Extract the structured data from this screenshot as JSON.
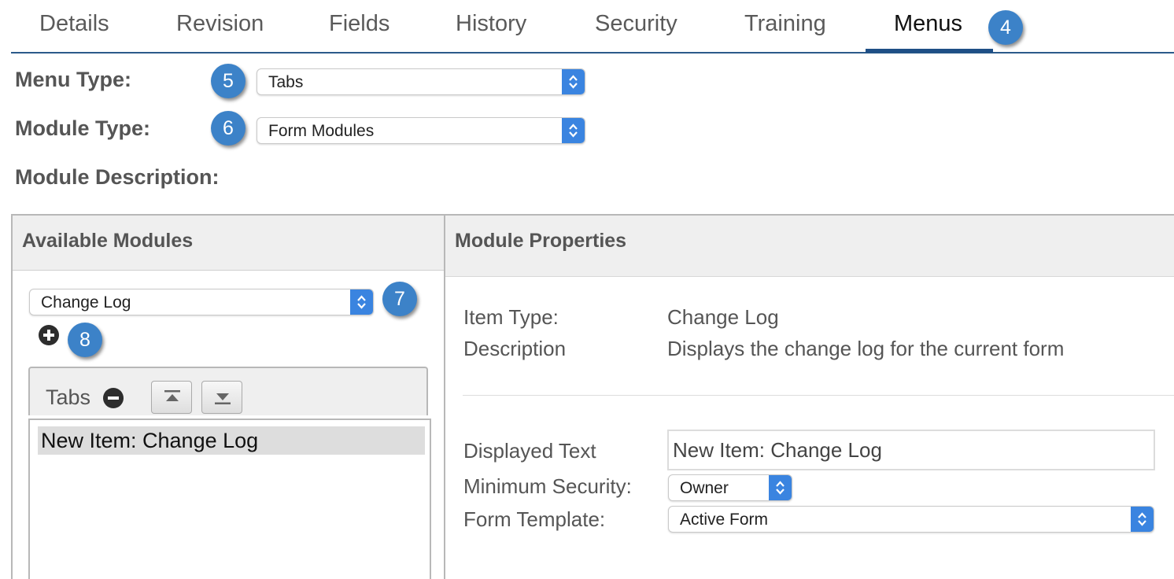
{
  "tabs": [
    {
      "label": "Details"
    },
    {
      "label": "Revision"
    },
    {
      "label": "Fields"
    },
    {
      "label": "History"
    },
    {
      "label": "Security"
    },
    {
      "label": "Training"
    },
    {
      "label": "Menus"
    }
  ],
  "active_tab": "Menus",
  "callouts": [
    "4",
    "5",
    "6",
    "7",
    "8"
  ],
  "form": {
    "menu_type_label": "Menu Type:",
    "menu_type_value": "Tabs",
    "module_type_label": "Module Type:",
    "module_type_value": "Form Modules",
    "module_description_label": "Module Description:"
  },
  "available_modules": {
    "title": "Available Modules",
    "selected_module": "Change Log",
    "tabs_label": "Tabs",
    "items": [
      "New Item: Change Log"
    ]
  },
  "module_properties": {
    "title": "Module Properties",
    "item_type_label": "Item Type:",
    "item_type_value": "Change Log",
    "description_label": "Description",
    "description_value": "Displays the change log for the current form",
    "displayed_text_label": "Displayed Text",
    "displayed_text_value": "New Item: Change Log",
    "minimum_security_label": "Minimum Security:",
    "minimum_security_value": "Owner",
    "form_template_label": "Form Template:",
    "form_template_value": "Active Form"
  },
  "colors": {
    "accent": "#3a84e0",
    "callout": "#3c82c8",
    "tab_underline": "#1f4f86"
  }
}
